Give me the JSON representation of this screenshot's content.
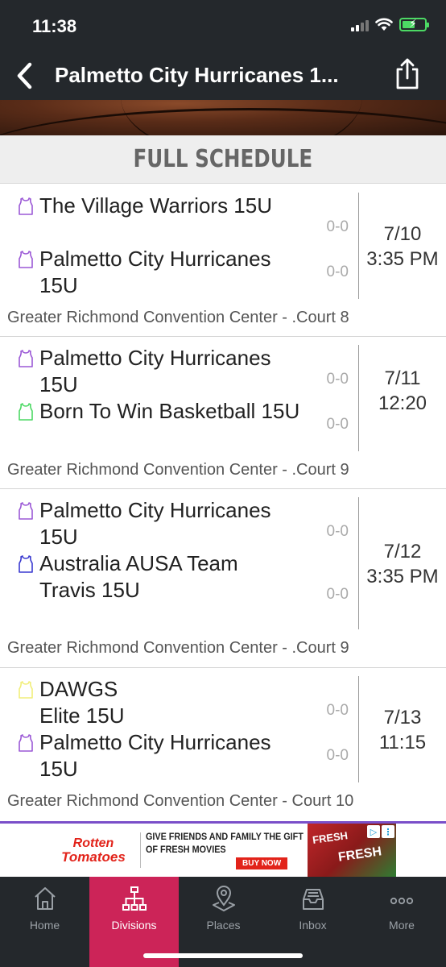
{
  "status_bar": {
    "time": "11:38"
  },
  "nav": {
    "title": "Palmetto City Hurricanes 1..."
  },
  "section": {
    "title": "FULL SCHEDULE"
  },
  "colors": {
    "purple_icon": "#9b59d6",
    "green_icon": "#4cd964",
    "blue_icon": "#3a3ad0",
    "yellow_icon": "#f1ee7a",
    "active_tab": "#cc2458"
  },
  "games": [
    {
      "teams": [
        {
          "name": "The Village Warriors 15U",
          "score": "0-0",
          "icon": "jersey-icon",
          "color": "#9b59d6"
        },
        {
          "name": "Palmetto City Hurricanes 15U",
          "score": "0-0",
          "icon": "jersey-icon",
          "color": "#9b59d6"
        }
      ],
      "date": "7/10",
      "time": "3:35 PM",
      "venue": "Greater Richmond Convention Center - .Court 8"
    },
    {
      "teams": [
        {
          "name": "Palmetto City Hurricanes 15U",
          "score": "0-0",
          "icon": "jersey-icon",
          "color": "#9b59d6"
        },
        {
          "name": "Born To Win Basketball 15U",
          "score": "0-0",
          "icon": "jersey-icon",
          "color": "#4cd964"
        }
      ],
      "date": "7/11",
      "time": "12:20",
      "venue": "Greater Richmond Convention Center - .Court 9"
    },
    {
      "teams": [
        {
          "name": "Palmetto City Hurricanes 15U",
          "score": "0-0",
          "icon": "jersey-icon",
          "color": "#9b59d6"
        },
        {
          "name": "Australia AUSA Team Travis 15U",
          "score": "0-0",
          "icon": "jersey-icon",
          "color": "#3a3ad0"
        }
      ],
      "date": "7/12",
      "time": "3:35 PM",
      "venue": "Greater Richmond Convention Center - .Court 9"
    },
    {
      "teams": [
        {
          "name": "DAWGS Elite 15U",
          "score": "0-0",
          "icon": "jersey-icon",
          "color": "#f1ee7a"
        },
        {
          "name": "Palmetto City Hurricanes 15U",
          "score": "0-0",
          "icon": "jersey-icon",
          "color": "#9b59d6"
        }
      ],
      "date": "7/13",
      "time": "11:15",
      "venue": "Greater Richmond Convention Center - Court 10"
    }
  ],
  "ad": {
    "brand_line1": "Rotten",
    "brand_line2": "Tomatoes",
    "line1": "GIVE FRIENDS AND FAMILY THE GIFT",
    "line2": "OF FRESH MOVIES",
    "cta": "BUY NOW",
    "image_text_top": "FRESH",
    "image_text": "FRESH"
  },
  "tabs": [
    {
      "label": "Home",
      "icon": "home-icon"
    },
    {
      "label": "Divisions",
      "icon": "bracket-icon",
      "active": true
    },
    {
      "label": "Places",
      "icon": "map-pin-icon"
    },
    {
      "label": "Inbox",
      "icon": "inbox-icon"
    },
    {
      "label": "More",
      "icon": "more-icon"
    }
  ]
}
